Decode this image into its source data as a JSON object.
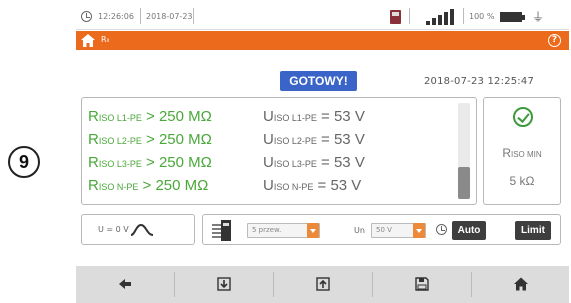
{
  "step_marker": "9",
  "statusbar": {
    "time": "12:26:06",
    "date": "2018-07-23",
    "battery_text": "100 %",
    "icons": [
      "clock-icon",
      "memory-card-icon",
      "signal-icon",
      "battery-icon",
      "power-plug-icon"
    ]
  },
  "header": {
    "label": "Rₗₗ",
    "icons": [
      "home-icon",
      "help-icon"
    ]
  },
  "status": {
    "ready_label": "GOTOWY!",
    "datetime": "2018-07-23 12:25:47"
  },
  "results": [
    {
      "r_main": "R",
      "r_sub": "ISO L1-PE",
      "r_value": " > 250 MΩ",
      "u_main": "U",
      "u_sub": "ISO L1-PE",
      "u_value": " = 53 V"
    },
    {
      "r_main": "R",
      "r_sub": "ISO L2-PE",
      "r_value": " > 250 MΩ",
      "u_main": "U",
      "u_sub": "ISO L2-PE",
      "u_value": " = 53 V"
    },
    {
      "r_main": "R",
      "r_sub": "ISO L3-PE",
      "r_value": " > 250 MΩ",
      "u_main": "U",
      "u_sub": "ISO L3-PE",
      "u_value": " = 53 V"
    },
    {
      "r_main": "R",
      "r_sub": "ISO N-PE",
      "r_value": " > 250 MΩ",
      "u_main": "U",
      "u_sub": "ISO N-PE",
      "u_value": " = 53 V"
    }
  ],
  "limit_panel": {
    "riso_min_main": "R",
    "riso_min_sub": "ISO MIN",
    "riso_min_value": "5 kΩ"
  },
  "settings": {
    "voltage_label": "U = 0 V",
    "probe_select": "5 przew.",
    "un_label": "Un",
    "un_select": "50 V",
    "auto_label": "Auto",
    "limit_label": "Limit"
  },
  "nav": [
    "back-arrow-icon",
    "download-icon",
    "upload-icon",
    "save-icon",
    "home-icon"
  ],
  "colors": {
    "accent": "#ec6a1c",
    "ready": "#3a64c8",
    "pass": "#4aa83a"
  }
}
